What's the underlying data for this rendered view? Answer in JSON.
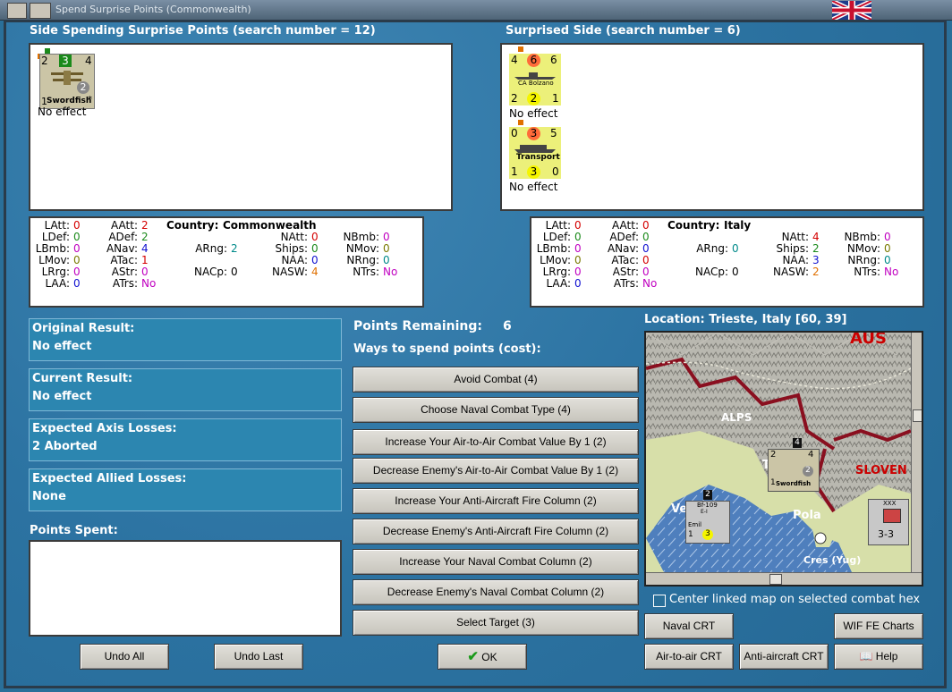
{
  "window": {
    "title": "Spend Surprise Points (Commonwealth)"
  },
  "left_side": {
    "header": "Side Spending Surprise Points (search number = 12)",
    "units": [
      {
        "name": "Swordfish",
        "top_left": "2",
        "top_mid": "3",
        "top_right": "4",
        "bottom_left": "1",
        "bottom_right": "2",
        "star": "*",
        "result": "No effect"
      }
    ]
  },
  "right_side": {
    "header": "Surprised Side (search number = 6)",
    "units": [
      {
        "name": "CA Bolzano",
        "top_left": "4",
        "top_mid": "6",
        "top_right": "6",
        "bottom_left": "2",
        "bottom_mid": "2",
        "bottom_right": "1",
        "result": "No effect"
      },
      {
        "name": "Transport",
        "top_left": "0",
        "top_mid": "3",
        "top_right": "5",
        "bottom_left": "1",
        "bottom_mid": "3",
        "bottom_right": "0",
        "result": "No effect"
      }
    ]
  },
  "left_stats": {
    "country_label": "Country:",
    "country": "Commonwealth",
    "LAtt": "0",
    "LDef": "0",
    "LBmb": "0",
    "LMov": "0",
    "LRrg": "0",
    "LAA": "0",
    "AAtt": "2",
    "ADef": "2",
    "ANav": "4",
    "ATac": "1",
    "AStr": "0",
    "ATrs": "No",
    "ARng": "2",
    "NACp": "0",
    "NAtt": "0",
    "Ships": "0",
    "NAA": "0",
    "NASW": "4",
    "NBmb": "0",
    "NMov": "0",
    "NRng": "0",
    "NTrs": "No"
  },
  "right_stats": {
    "country_label": "Country:",
    "country": "Italy",
    "LAtt": "0",
    "LDef": "0",
    "LBmb": "0",
    "LMov": "0",
    "LRrg": "0",
    "LAA": "0",
    "AAtt": "0",
    "ADef": "0",
    "ANav": "0",
    "ATac": "0",
    "AStr": "0",
    "ATrs": "No",
    "ARng": "0",
    "NACp": "0",
    "NAtt": "4",
    "Ships": "2",
    "NAA": "3",
    "NASW": "2",
    "NBmb": "0",
    "NMov": "0",
    "NRng": "0",
    "NTrs": "No"
  },
  "stat_labels": {
    "LAtt": "LAtt:",
    "LDef": "LDef:",
    "LBmb": "LBmb:",
    "LMov": "LMov:",
    "LRrg": "LRrg:",
    "LAA": "LAA:",
    "AAtt": "AAtt:",
    "ADef": "ADef:",
    "ANav": "ANav:",
    "ATac": "ATac:",
    "AStr": "AStr:",
    "ATrs": "ATrs:",
    "ARng": "ARng:",
    "NACp": "NACp:",
    "NAtt": "NAtt:",
    "Ships": "Ships:",
    "NAA": "NAA:",
    "NASW": "NASW:",
    "NBmb": "NBmb:",
    "NMov": "NMov:",
    "NRng": "NRng:",
    "NTrs": "NTrs:"
  },
  "results": {
    "original_label": "Original Result:",
    "original_value": "No effect",
    "current_label": "Current Result:",
    "current_value": "No effect",
    "axis_label": "Expected Axis Losses:",
    "axis_value": "2 Aborted",
    "allied_label": "Expected Allied Losses:",
    "allied_value": "None",
    "points_spent_label": "Points Spent:"
  },
  "points": {
    "remaining_label": "Points Remaining:",
    "remaining_value": "6",
    "ways_label": "Ways to spend points (cost):"
  },
  "options": [
    "Avoid Combat (4)",
    "Choose Naval Combat Type (4)",
    "Increase Your Air-to-Air Combat Value By 1 (2)",
    "Decrease Enemy's Air-to-Air Combat Value By 1 (2)",
    "Increase Your Anti-Aircraft Fire Column (2)",
    "Decrease Enemy's Anti-Aircraft Fire Column (2)",
    "Increase Your Naval Combat Column (2)",
    "Decrease Enemy's Naval Combat Column (2)",
    "Select Target (3)"
  ],
  "map": {
    "location": "Location: Trieste, Italy [60, 39]",
    "labels": {
      "alps": "ALPS",
      "aus": "AUS",
      "slov": "SLOVEN",
      "pola": "Pola",
      "cres": "Cres (Yug)",
      "tr": "Tr",
      "ve": "Ve"
    },
    "bf109": {
      "name": "Bf-109",
      "sub": "E-I",
      "pilot": "Emil",
      "left": "1",
      "mid": "3",
      "count": "2"
    },
    "swordfish": {
      "name": "Swordfish",
      "top_left": "2",
      "top_right": "4",
      "bottom_left": "1",
      "bottom_right": "2",
      "count": "4"
    },
    "yugo": {
      "name": "XXX",
      "strength": "3-3",
      "side": "V"
    },
    "center_linked": "Center linked map on selected combat hex"
  },
  "buttons": {
    "undo_all": "Undo All",
    "undo_last": "Undo Last",
    "ok": "OK",
    "naval_crt": "Naval CRT",
    "wif_charts": "WIF FE Charts",
    "air_crt": "Air-to-air CRT",
    "aa_crt": "Anti-aircraft CRT",
    "help": "Help"
  },
  "colors": {
    "panel": "#2c86b0",
    "background": "#2a6f99",
    "counter_italy": "#ecf07a"
  }
}
